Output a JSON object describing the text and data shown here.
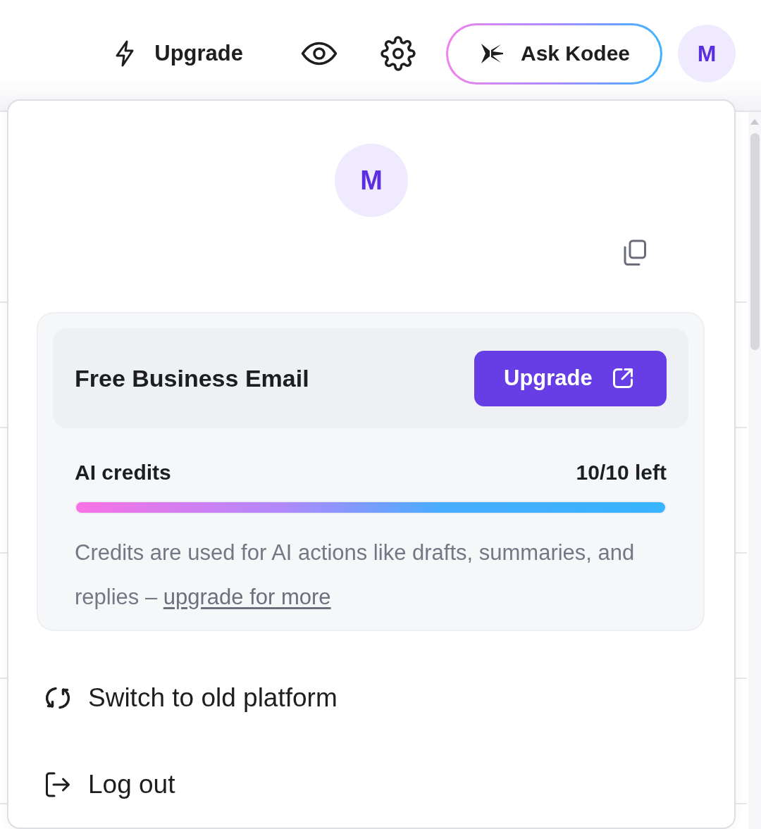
{
  "top_bar": {
    "upgrade_link": "Upgrade",
    "assistant_button": "Ask Kodee",
    "avatar_initial": "M"
  },
  "account_menu": {
    "avatar_initial": "M",
    "plan": {
      "name": "Free Business Email",
      "upgrade_button": "Upgrade"
    },
    "credits": {
      "label": "AI credits",
      "reading": "10/10 left",
      "level": 1,
      "note": "Credits are used for AI actions like drafts, summaries, and replies –",
      "note_link": "upgrade for more"
    },
    "items": [
      {
        "kind": "switch",
        "label": "Switch to old platform"
      },
      {
        "kind": "logout",
        "label": "Log out"
      }
    ]
  }
}
